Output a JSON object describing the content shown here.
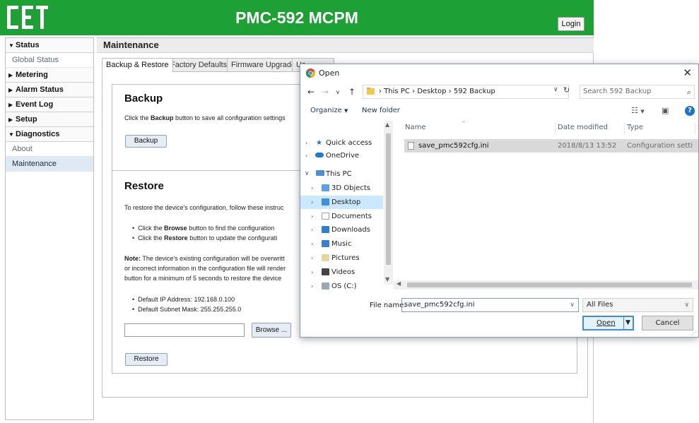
{
  "app": {
    "header_title": "PMC-592 MCPM",
    "login_label": "Login",
    "brand_color": "#1ea134"
  },
  "sidebar": {
    "items": [
      {
        "label": "Status",
        "type": "group",
        "expanded": true
      },
      {
        "label": "Global Status",
        "type": "sub"
      },
      {
        "label": "Metering",
        "type": "group",
        "expanded": false
      },
      {
        "label": "Alarm Status",
        "type": "group",
        "expanded": false
      },
      {
        "label": "Event Log",
        "type": "group",
        "expanded": false
      },
      {
        "label": "Setup",
        "type": "group",
        "expanded": false
      },
      {
        "label": "Diagnostics",
        "type": "group",
        "expanded": true
      },
      {
        "label": "About",
        "type": "sub"
      },
      {
        "label": "Maintenance",
        "type": "sub",
        "active": true
      }
    ]
  },
  "content": {
    "title": "Maintenance",
    "tabs": [
      "Backup & Restore",
      "Factory Defaults",
      "Firmware Upgrade",
      "Us"
    ],
    "backup": {
      "heading": "Backup",
      "text_pre": "Click the ",
      "text_bold": "Backup",
      "text_post": " button to save all configuration settings",
      "button": "Backup"
    },
    "restore": {
      "heading": "Restore",
      "intro": "To restore the device's configuration, follow these instruc",
      "bullet1_pre": "Click the ",
      "bullet1_bold": "Browse",
      "bullet1_post": " button to find the configuration",
      "bullet2_pre": "Click the ",
      "bullet2_bold": "Restore",
      "bullet2_post": " button to update the configurati",
      "note_bold": "Note:",
      "note_line1": " The device's existing configuration will be overwritt",
      "note_line2": "or incorrect information in the configuration file will render",
      "note_line3": "button for a minimum of 5 seconds to restore the device",
      "default_ip": "Default IP Address: 192.168.0.100",
      "default_mask": "Default Subnet Mask: 255.255.255.0",
      "file_value": "",
      "browse_button": "Browse ...",
      "restore_button": "Restore"
    }
  },
  "dialog": {
    "title": "Open",
    "breadcrumb": [
      "This PC",
      "Desktop",
      "592 Backup"
    ],
    "search_placeholder": "Search 592 Backup",
    "organize_label": "Organize",
    "new_folder_label": "New folder",
    "nav_items": [
      {
        "label": "Quick access",
        "icon": "star-icon",
        "level": 0,
        "chevron": "right"
      },
      {
        "label": "OneDrive",
        "icon": "cloud-icon",
        "level": 0,
        "chevron": "right"
      },
      {
        "label": "This PC",
        "icon": "computer-icon",
        "level": 0,
        "chevron": "down"
      },
      {
        "label": "3D Objects",
        "icon": "folder-3d-icon",
        "level": 1,
        "chevron": "right"
      },
      {
        "label": "Desktop",
        "icon": "desktop-folder-icon",
        "level": 1,
        "chevron": "right",
        "selected": true
      },
      {
        "label": "Documents",
        "icon": "documents-icon",
        "level": 1,
        "chevron": "right"
      },
      {
        "label": "Downloads",
        "icon": "downloads-icon",
        "level": 1,
        "chevron": "right"
      },
      {
        "label": "Music",
        "icon": "music-icon",
        "level": 1,
        "chevron": "right"
      },
      {
        "label": "Pictures",
        "icon": "pictures-icon",
        "level": 1,
        "chevron": "right"
      },
      {
        "label": "Videos",
        "icon": "videos-icon",
        "level": 1,
        "chevron": "right"
      },
      {
        "label": "OS (C:)",
        "icon": "drive-icon",
        "level": 1,
        "chevron": "right"
      }
    ],
    "columns": [
      "Name",
      "Date modified",
      "Type",
      "S"
    ],
    "files": [
      {
        "name": "save_pmc592cfg.ini",
        "modified": "2018/8/13 13:52",
        "type": "Configuration setti"
      }
    ],
    "file_name_label": "File name:",
    "file_name_value": "save_pmc592cfg.ini",
    "filter_value": "All Files",
    "open_label": "Open",
    "cancel_label": "Cancel"
  }
}
